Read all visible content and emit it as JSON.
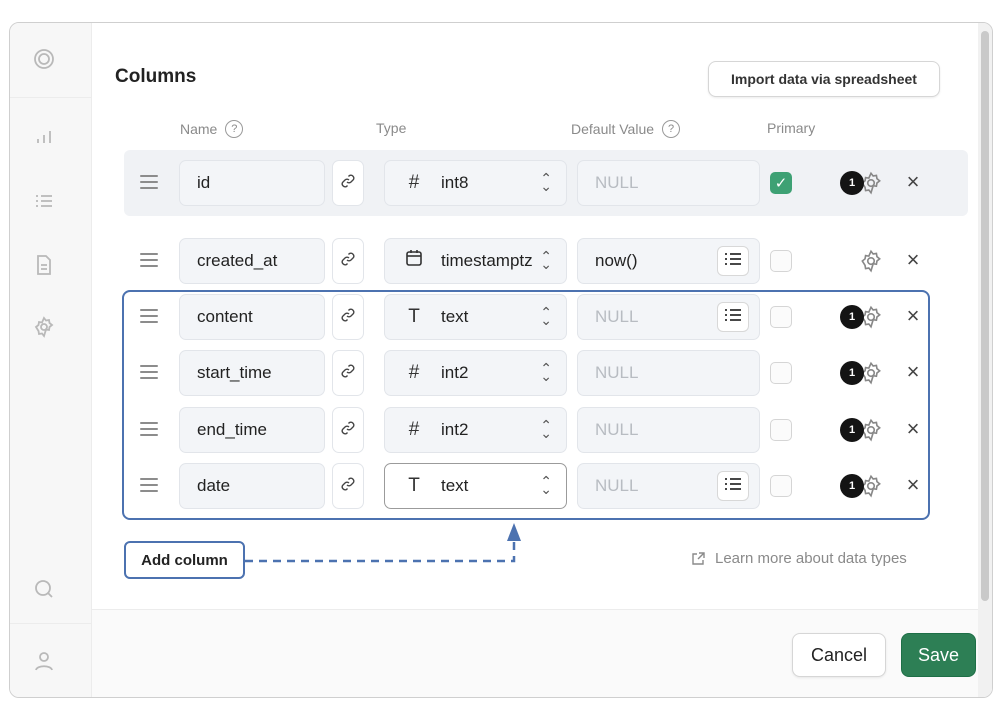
{
  "section": {
    "title": "Columns",
    "import_button": "Import data via spreadsheet"
  },
  "headers": {
    "name": "Name",
    "type": "Type",
    "default_value": "Default Value",
    "primary": "Primary",
    "help_glyph": "?"
  },
  "columns": [
    {
      "name": "id",
      "type_icon": "hash-icon",
      "type_glyph": "#",
      "type": "int8",
      "default": "NULL",
      "default_is_placeholder": true,
      "has_list_button": false,
      "primary": true,
      "badge": "1",
      "show_badge": true
    },
    {
      "name": "created_at",
      "type_icon": "calendar-icon",
      "type_glyph": "",
      "type": "timestamptz",
      "default": "now()",
      "default_is_placeholder": false,
      "has_list_button": true,
      "primary": false,
      "badge": "",
      "show_badge": false
    },
    {
      "name": "content",
      "type_icon": "text-type-icon",
      "type_glyph": "T",
      "type": "text",
      "default": "NULL",
      "default_is_placeholder": true,
      "has_list_button": true,
      "primary": false,
      "badge": "1",
      "show_badge": true
    },
    {
      "name": "start_time",
      "type_icon": "hash-icon",
      "type_glyph": "#",
      "type": "int2",
      "default": "NULL",
      "default_is_placeholder": true,
      "has_list_button": false,
      "primary": false,
      "badge": "1",
      "show_badge": true
    },
    {
      "name": "end_time",
      "type_icon": "hash-icon",
      "type_glyph": "#",
      "type": "int2",
      "default": "NULL",
      "default_is_placeholder": true,
      "has_list_button": false,
      "primary": false,
      "badge": "1",
      "show_badge": true
    },
    {
      "name": "date",
      "type_icon": "text-type-icon",
      "type_glyph": "T",
      "type": "text",
      "default": "NULL",
      "default_is_placeholder": true,
      "has_list_button": true,
      "primary": false,
      "badge": "1",
      "show_badge": true
    }
  ],
  "add_column_button": "Add column",
  "learn_more_link": "Learn more about data types",
  "footer": {
    "cancel": "Cancel",
    "save": "Save"
  },
  "colors": {
    "highlight": "#4c72b0",
    "save": "#2d7f55",
    "primary_check": "#3ea174"
  },
  "sidebar_icons": [
    "logo-icon",
    "chart-icon",
    "list-icon",
    "document-icon",
    "settings-icon",
    "search-icon",
    "user-icon"
  ]
}
